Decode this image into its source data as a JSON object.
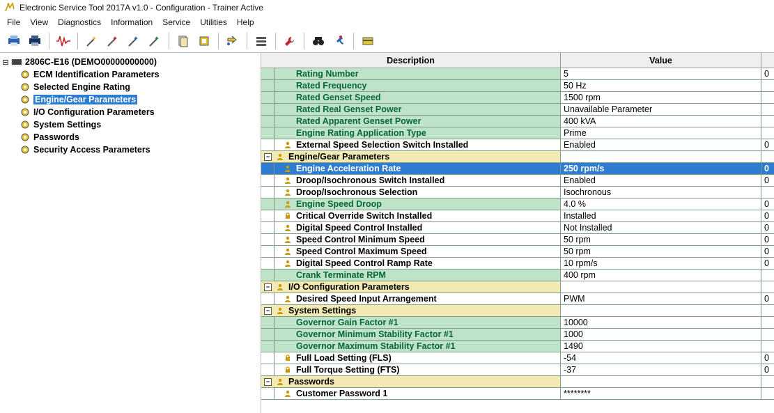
{
  "window": {
    "title": "Electronic Service Tool 2017A v1.0 - Configuration - Trainer Active"
  },
  "menu": [
    "File",
    "View",
    "Diagnostics",
    "Information",
    "Service",
    "Utilities",
    "Help"
  ],
  "toolbar_icons": [
    "printer-blue-icon",
    "printer-dark-icon",
    "sep",
    "waveform-icon",
    "sep",
    "wand-yellow-icon",
    "wand-red-icon",
    "wand-blue-icon",
    "wand-green-icon",
    "sep",
    "document-stack-icon",
    "chip-yellow-icon",
    "sep",
    "arrows-right-icon",
    "sep",
    "bars-icon",
    "sep",
    "wrench-red-icon",
    "sep",
    "binoculars-icon",
    "running-man-icon",
    "sep",
    "card-yellow-icon"
  ],
  "tree": {
    "root": {
      "label": "2806C-E16 (DEMO00000000000)"
    },
    "children": [
      {
        "label": "ECM Identification Parameters",
        "selected": false
      },
      {
        "label": "Selected Engine Rating",
        "selected": false
      },
      {
        "label": "Engine/Gear Parameters",
        "selected": true
      },
      {
        "label": "I/O Configuration Parameters",
        "selected": false
      },
      {
        "label": "System Settings",
        "selected": false
      },
      {
        "label": "Passwords",
        "selected": false
      },
      {
        "label": "Security Access Parameters",
        "selected": false
      }
    ]
  },
  "grid": {
    "headers": {
      "description": "Description",
      "value": "Value",
      "extra": ""
    },
    "rows": [
      {
        "type": "leaf-green",
        "indent": 2,
        "icon": "",
        "desc": "Rating Number",
        "val": "5",
        "extra": "0"
      },
      {
        "type": "leaf-green",
        "indent": 2,
        "icon": "",
        "desc": "Rated Frequency",
        "val": "50 Hz",
        "extra": ""
      },
      {
        "type": "leaf-green",
        "indent": 2,
        "icon": "",
        "desc": "Rated Genset Speed",
        "val": "1500 rpm",
        "extra": ""
      },
      {
        "type": "leaf-green",
        "indent": 2,
        "icon": "",
        "desc": "Rated Real Genset Power",
        "val": "Unavailable Parameter",
        "extra": ""
      },
      {
        "type": "leaf-green",
        "indent": 2,
        "icon": "",
        "desc": "Rated Apparent Genset Power",
        "val": "400 kVA",
        "extra": ""
      },
      {
        "type": "leaf-green",
        "indent": 2,
        "icon": "",
        "desc": "Engine Rating Application Type",
        "val": "Prime",
        "extra": ""
      },
      {
        "type": "leaf-plain",
        "indent": 2,
        "icon": "person",
        "desc": "External Speed Selection Switch Installed",
        "val": "Enabled",
        "extra": "0"
      },
      {
        "type": "group",
        "indent": 0,
        "icon": "person",
        "desc": "Engine/Gear Parameters",
        "val": "",
        "extra": ""
      },
      {
        "type": "selected",
        "indent": 2,
        "icon": "person",
        "desc": "Engine Acceleration Rate",
        "val": "250 rpm/s",
        "extra": "0"
      },
      {
        "type": "leaf-plain",
        "indent": 2,
        "icon": "person",
        "desc": "Droop/Isochronous Switch Installed",
        "val": "Enabled",
        "extra": "0"
      },
      {
        "type": "leaf-plain",
        "indent": 2,
        "icon": "person",
        "desc": "Droop/Isochronous Selection",
        "val": "Isochronous",
        "extra": ""
      },
      {
        "type": "leaf-green",
        "indent": 2,
        "icon": "person",
        "desc": "Engine Speed Droop",
        "val": "4.0 %",
        "extra": "0"
      },
      {
        "type": "leaf-plain",
        "indent": 2,
        "icon": "lock",
        "desc": "Critical Override Switch Installed",
        "val": "Installed",
        "extra": "0"
      },
      {
        "type": "leaf-plain",
        "indent": 2,
        "icon": "person",
        "desc": "Digital Speed Control Installed",
        "val": "Not Installed",
        "extra": "0"
      },
      {
        "type": "leaf-plain",
        "indent": 2,
        "icon": "person",
        "desc": "Speed Control Minimum Speed",
        "val": "50 rpm",
        "extra": "0"
      },
      {
        "type": "leaf-plain",
        "indent": 2,
        "icon": "person",
        "desc": "Speed Control Maximum Speed",
        "val": "50 rpm",
        "extra": "0"
      },
      {
        "type": "leaf-plain",
        "indent": 2,
        "icon": "person",
        "desc": "Digital Speed Control Ramp Rate",
        "val": "10 rpm/s",
        "extra": "0"
      },
      {
        "type": "leaf-green",
        "indent": 2,
        "icon": "",
        "desc": "Crank Terminate RPM",
        "val": "400 rpm",
        "extra": ""
      },
      {
        "type": "group",
        "indent": 0,
        "icon": "person",
        "desc": "I/O Configuration Parameters",
        "val": "",
        "extra": ""
      },
      {
        "type": "leaf-plain",
        "indent": 2,
        "icon": "person",
        "desc": "Desired Speed Input Arrangement",
        "val": "PWM",
        "extra": "0"
      },
      {
        "type": "group",
        "indent": 0,
        "icon": "person",
        "desc": "System Settings",
        "val": "",
        "extra": ""
      },
      {
        "type": "leaf-green",
        "indent": 2,
        "icon": "",
        "desc": "Governor Gain Factor #1",
        "val": "10000",
        "extra": ""
      },
      {
        "type": "leaf-green",
        "indent": 2,
        "icon": "",
        "desc": "Governor Minimum Stability Factor #1",
        "val": "1000",
        "extra": ""
      },
      {
        "type": "leaf-green",
        "indent": 2,
        "icon": "",
        "desc": "Governor Maximum Stability Factor #1",
        "val": "1490",
        "extra": ""
      },
      {
        "type": "leaf-plain",
        "indent": 2,
        "icon": "lock",
        "desc": "Full Load Setting (FLS)",
        "val": "-54",
        "extra": "0"
      },
      {
        "type": "leaf-plain",
        "indent": 2,
        "icon": "lock",
        "desc": "Full Torque Setting (FTS)",
        "val": "-37",
        "extra": "0"
      },
      {
        "type": "group",
        "indent": 0,
        "icon": "person",
        "desc": "Passwords",
        "val": "",
        "extra": ""
      },
      {
        "type": "leaf-plain",
        "indent": 2,
        "icon": "person",
        "desc": "Customer Password 1",
        "val": "********",
        "extra": ""
      }
    ]
  }
}
